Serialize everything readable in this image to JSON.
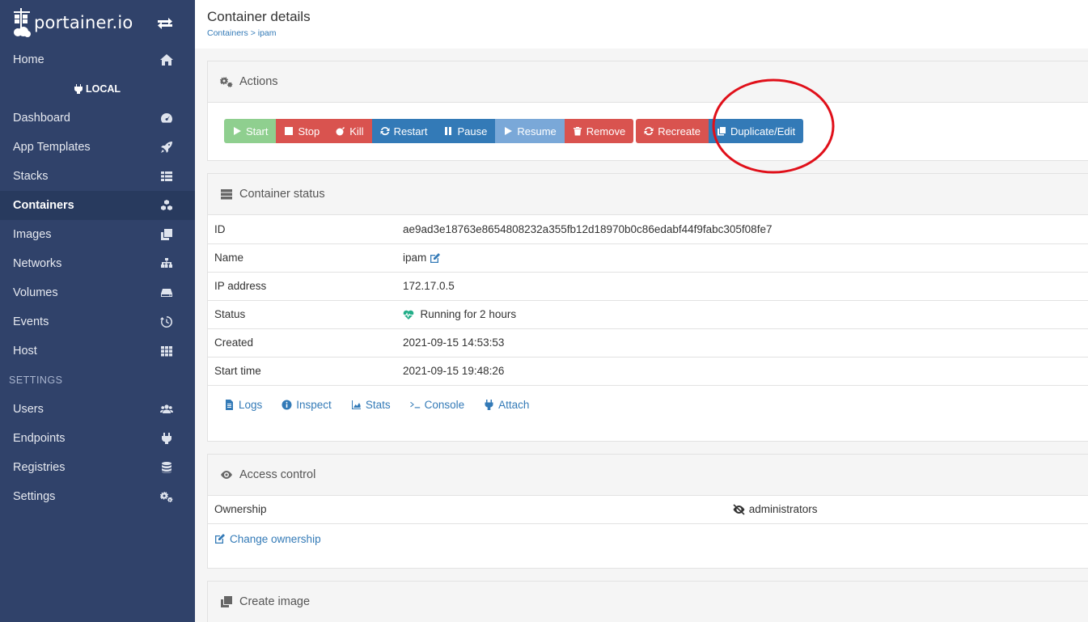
{
  "brand": {
    "name": "portainer.io"
  },
  "sidebar": {
    "items": [
      {
        "label": "Home",
        "icon": "home-icon"
      },
      {
        "label": "Dashboard",
        "icon": "tachometer-icon"
      },
      {
        "label": "App Templates",
        "icon": "rocket-icon"
      },
      {
        "label": "Stacks",
        "icon": "list-icon"
      },
      {
        "label": "Containers",
        "icon": "cubes-icon"
      },
      {
        "label": "Images",
        "icon": "clone-icon"
      },
      {
        "label": "Networks",
        "icon": "sitemap-icon"
      },
      {
        "label": "Volumes",
        "icon": "hdd-icon"
      },
      {
        "label": "Events",
        "icon": "history-icon"
      },
      {
        "label": "Host",
        "icon": "th-icon"
      }
    ],
    "endpoint": "LOCAL",
    "settings_heading": "SETTINGS",
    "settings_items": [
      {
        "label": "Users",
        "icon": "users-icon"
      },
      {
        "label": "Endpoints",
        "icon": "plug-icon"
      },
      {
        "label": "Registries",
        "icon": "database-icon"
      },
      {
        "label": "Settings",
        "icon": "cogs-icon"
      }
    ]
  },
  "header": {
    "title": "Container details",
    "breadcrumb": "Containers > ipam"
  },
  "actions": {
    "title": "Actions",
    "buttons": {
      "start": "Start",
      "stop": "Stop",
      "kill": "Kill",
      "restart": "Restart",
      "pause": "Pause",
      "resume": "Resume",
      "remove": "Remove",
      "recreate": "Recreate",
      "duplicate": "Duplicate/Edit"
    }
  },
  "status": {
    "title": "Container status",
    "rows": [
      {
        "key": "ID",
        "value": "ae9ad3e18763e8654808232a355fb12d18970b0c86edabf44f9fabc305f08fe7"
      },
      {
        "key": "Name",
        "value": "ipam"
      },
      {
        "key": "IP address",
        "value": "172.17.0.5"
      },
      {
        "key": "Status",
        "value": "Running for 2 hours"
      },
      {
        "key": "Created",
        "value": "2021-09-15 14:53:53"
      },
      {
        "key": "Start time",
        "value": "2021-09-15 19:48:26"
      }
    ],
    "links": {
      "logs": "Logs",
      "inspect": "Inspect",
      "stats": "Stats",
      "console": "Console",
      "attach": "Attach"
    }
  },
  "access": {
    "title": "Access control",
    "ownership_label": "Ownership",
    "ownership_value": "administrators",
    "change_link": "Change ownership"
  },
  "create_image": {
    "title": "Create image"
  },
  "colors": {
    "sidebar": "#30426a",
    "primary": "#337ab7",
    "danger": "#d9534f",
    "success": "#8fcf8f",
    "annotation": "#e0101a",
    "running": "#23ae89"
  }
}
